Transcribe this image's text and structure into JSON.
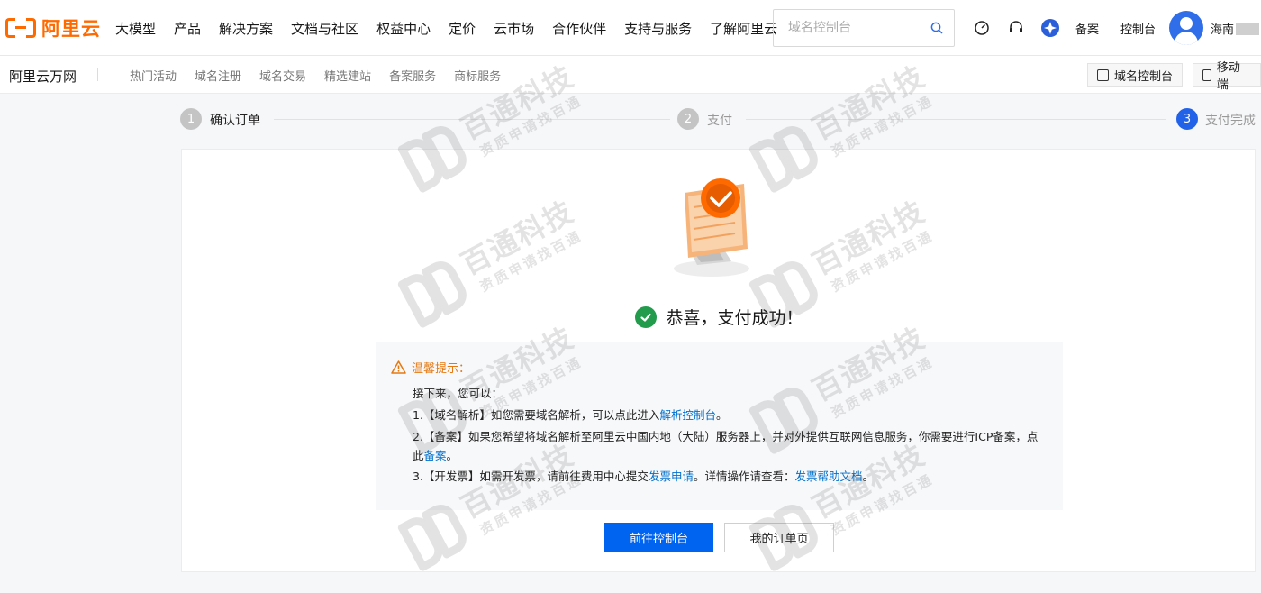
{
  "header": {
    "logo_text": "阿里云",
    "nav": [
      "大模型",
      "产品",
      "解决方案",
      "文档与社区",
      "权益中心",
      "定价",
      "云市场",
      "合作伙伴",
      "支持与服务",
      "了解阿里云"
    ],
    "search_placeholder": "域名控制台",
    "tools": {
      "beian": "备案",
      "console": "控制台"
    },
    "username": "海南"
  },
  "subnav": {
    "brand": "阿里云万网",
    "items": [
      "热门活动",
      "域名注册",
      "域名交易",
      "精选建站",
      "备案服务",
      "商标服务"
    ],
    "domain_console": "域名控制台",
    "mobile": "移动端"
  },
  "steps": [
    {
      "num": "1",
      "label": "确认订单",
      "state": "done"
    },
    {
      "num": "2",
      "label": "支付",
      "state": "done"
    },
    {
      "num": "3",
      "label": "支付完成",
      "state": "active"
    }
  ],
  "result": {
    "message": "恭喜，支付成功！",
    "tips_title": "温馨提示：",
    "intro": "接下来，您可以：",
    "tip1_text": "1.【域名解析】如您需要域名解析，可以点此进入",
    "tip1_link": "解析控制台",
    "tip1_end": "。",
    "tip2_text": "2.【备案】如果您希望将域名解析至阿里云中国内地（大陆）服务器上，并对外提供互联网信息服务，你需要进行ICP备案，点此",
    "tip2_link": "备案",
    "tip2_end": "。",
    "tip3_text": "3.【开发票】如需开发票，请前往费用中心提交",
    "tip3_link1": "发票申请",
    "tip3_mid": "。详情操作请查看：",
    "tip3_link2": "发票帮助文档",
    "tip3_end": "。"
  },
  "buttons": {
    "primary": "前往控制台",
    "secondary": "我的订单页"
  },
  "watermark": {
    "title": "百通科技",
    "subtitle": "资质申请找百通"
  },
  "colors": {
    "brand": "#ff6a00",
    "primary": "#0064f0",
    "success": "#239b4c",
    "link": "#0070cc",
    "warning": "#e6780f"
  }
}
